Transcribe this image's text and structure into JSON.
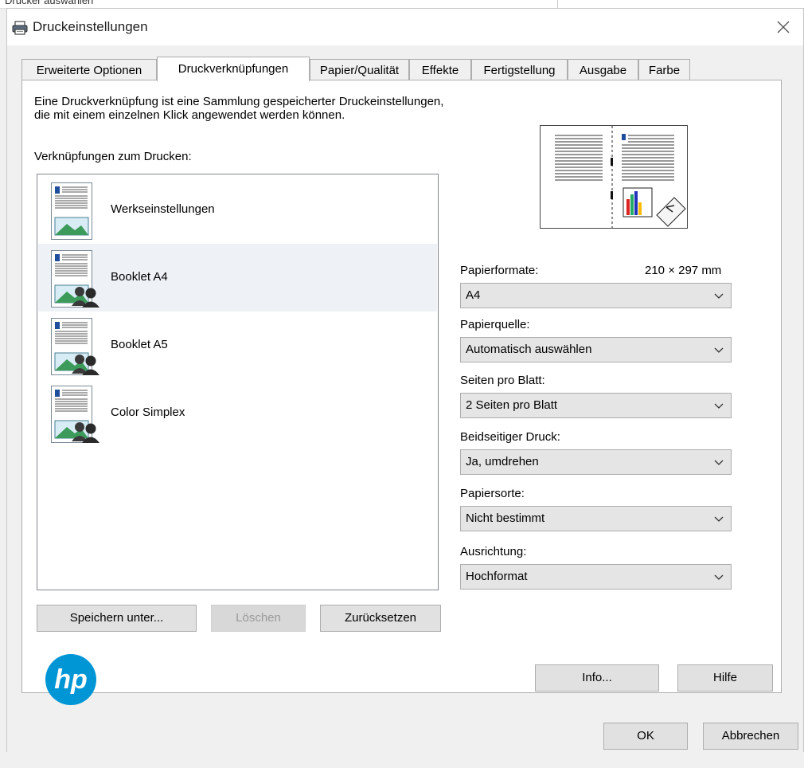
{
  "background": {
    "text": "Drucker auswählen"
  },
  "window": {
    "title": "Druckeinstellungen",
    "printer_icon": "printer-icon",
    "close_icon": "close-icon"
  },
  "tabs": [
    {
      "label": "Erweiterte Optionen",
      "active": false
    },
    {
      "label": "Druckverknüpfungen",
      "active": true
    },
    {
      "label": "Papier/Qualität",
      "active": false
    },
    {
      "label": "Effekte",
      "active": false
    },
    {
      "label": "Fertigstellung",
      "active": false
    },
    {
      "label": "Ausgabe",
      "active": false
    },
    {
      "label": "Farbe",
      "active": false
    }
  ],
  "shortcuts": {
    "description_line1": "Eine Druckverknüpfung ist eine Sammlung gespeicherter Druckeinstellungen,",
    "description_line2": "die mit einem einzelnen Klick angewendet werden können.",
    "list_label": "Verknüpfungen zum Drucken:",
    "items": [
      {
        "label": "Werkseinstellungen",
        "icon": "document-landscape-icon",
        "selected": false
      },
      {
        "label": "Booklet A4",
        "icon": "document-users-icon",
        "selected": true
      },
      {
        "label": "Booklet A5",
        "icon": "document-users-icon",
        "selected": false
      },
      {
        "label": "Color Simplex",
        "icon": "document-users-icon",
        "selected": false
      }
    ],
    "buttons": {
      "save_as": "Speichern unter...",
      "delete": "Löschen",
      "reset": "Zurücksetzen"
    }
  },
  "settings": {
    "paper_format": {
      "label": "Papierformate:",
      "size_value": "210 × 297 mm",
      "value": "A4"
    },
    "paper_source": {
      "label": "Papierquelle:",
      "value": "Automatisch auswählen"
    },
    "pages_per_sheet": {
      "label": "Seiten pro Blatt:",
      "value": "2 Seiten pro Blatt"
    },
    "duplex": {
      "label": "Beidseitiger Druck:",
      "value": "Ja, umdrehen"
    },
    "paper_type": {
      "label": "Papiersorte:",
      "value": "Nicht bestimmt"
    },
    "orientation": {
      "label": "Ausrichtung:",
      "value": "Hochformat"
    }
  },
  "brand": {
    "logo_text": "hp",
    "color": "#0096d6"
  },
  "panel_buttons": {
    "info": "Info...",
    "help": "Hilfe"
  },
  "dialog_buttons": {
    "ok": "OK",
    "cancel": "Abbrechen"
  }
}
